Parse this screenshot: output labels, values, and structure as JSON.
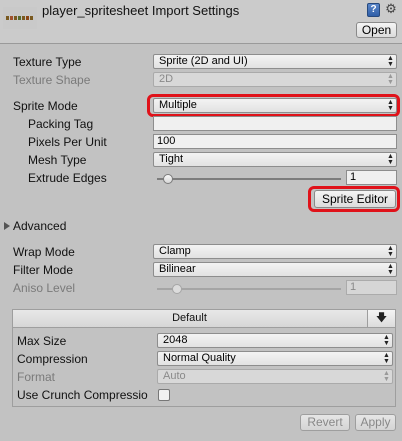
{
  "header": {
    "title": "player_spritesheet Import Settings",
    "open_label": "Open",
    "help_icon_glyph": "?",
    "gear_icon_glyph": "⚙"
  },
  "settings": {
    "texture_type": {
      "label": "Texture Type",
      "value": "Sprite (2D and UI)"
    },
    "texture_shape": {
      "label": "Texture Shape",
      "value": "2D"
    },
    "sprite_mode": {
      "label": "Sprite Mode",
      "value": "Multiple"
    },
    "packing_tag": {
      "label": "Packing Tag",
      "value": ""
    },
    "pixels_per_unit": {
      "label": "Pixels Per Unit",
      "value": "100"
    },
    "mesh_type": {
      "label": "Mesh Type",
      "value": "Tight"
    },
    "extrude_edges": {
      "label": "Extrude Edges",
      "value": "1",
      "slider_fraction": 0.03
    },
    "sprite_editor_label": "Sprite Editor"
  },
  "advanced": {
    "label": "Advanced"
  },
  "wrap": {
    "wrap_mode": {
      "label": "Wrap Mode",
      "value": "Clamp"
    },
    "filter_mode": {
      "label": "Filter Mode",
      "value": "Bilinear"
    },
    "aniso_level": {
      "label": "Aniso Level",
      "value": "1",
      "slider_fraction": 0.08
    }
  },
  "platform": {
    "tab_label": "Default",
    "download_icon_glyph": "🡇",
    "max_size": {
      "label": "Max Size",
      "value": "2048"
    },
    "compression": {
      "label": "Compression",
      "value": "Normal Quality"
    },
    "format": {
      "label": "Format",
      "value": "Auto"
    },
    "crunch": {
      "label": "Use Crunch Compressio",
      "checked": false
    }
  },
  "footer": {
    "revert_label": "Revert",
    "apply_label": "Apply"
  },
  "colors": {
    "background": "#c2c2c2",
    "highlight": "#e0121a",
    "disabled_text": "#7a7a7a"
  }
}
